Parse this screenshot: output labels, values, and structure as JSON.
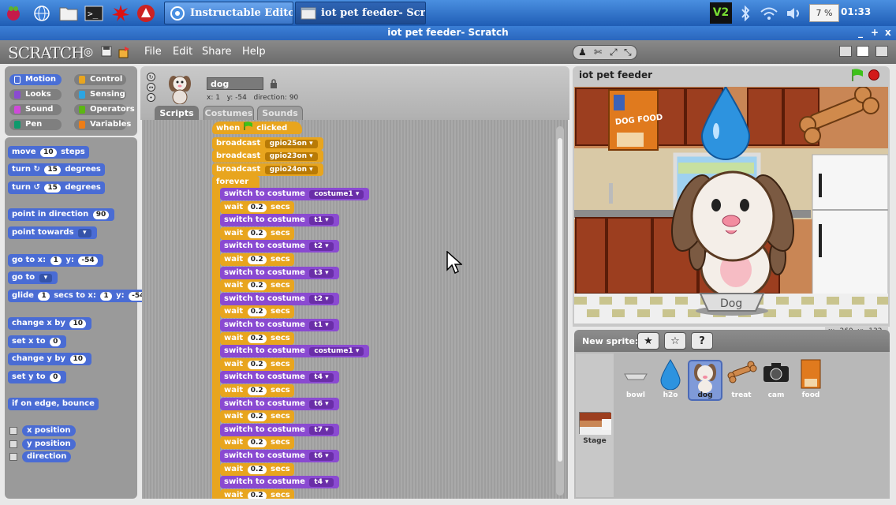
{
  "taskbar": {
    "tasks": [
      {
        "label": "Instructable Edito..."
      },
      {
        "label": "iot pet feeder- Scr..."
      }
    ],
    "volume_pct": "7 %",
    "clock": "01:33"
  },
  "window": {
    "title": "iot pet feeder- Scratch",
    "buttons": [
      "_",
      "+",
      "x"
    ]
  },
  "menubar": {
    "logo": "SCRATCH",
    "menus": [
      "File",
      "Edit",
      "Share",
      "Help"
    ]
  },
  "categories": [
    {
      "label": "Motion",
      "color": "#4a6cd4"
    },
    {
      "label": "Control",
      "color": "#e8a51e"
    },
    {
      "label": "Looks",
      "color": "#8a4ad1"
    },
    {
      "label": "Sensing",
      "color": "#2ca5e2"
    },
    {
      "label": "Sound",
      "color": "#cf4ad9"
    },
    {
      "label": "Operators",
      "color": "#5cb712"
    },
    {
      "label": "Pen",
      "color": "#0e9a6c"
    },
    {
      "label": "Variables",
      "color": "#ee7d16"
    }
  ],
  "palette": {
    "move": {
      "a": "move",
      "n": "10",
      "b": "steps"
    },
    "turn_cw": {
      "a": "turn",
      "n": "15",
      "b": "degrees"
    },
    "turn_ccw": {
      "a": "turn",
      "n": "15",
      "b": "degrees"
    },
    "point_dir": {
      "a": "point in direction",
      "n": "90"
    },
    "point_towards": {
      "a": "point towards"
    },
    "goto_xy": {
      "a": "go to x:",
      "x": "1",
      "y_label": "y:",
      "y": "-54"
    },
    "goto": {
      "a": "go to"
    },
    "glide": {
      "a": "glide",
      "n": "1",
      "b": "secs to x:",
      "x": "1",
      "y_label": "y:",
      "y": "-54"
    },
    "change_x": {
      "a": "change x by",
      "n": "10"
    },
    "set_x": {
      "a": "set x to",
      "n": "0"
    },
    "change_y": {
      "a": "change y by",
      "n": "10"
    },
    "set_y": {
      "a": "set y to",
      "n": "0"
    },
    "bounce": {
      "a": "if on edge, bounce"
    },
    "reporters": [
      "x position",
      "y position",
      "direction"
    ]
  },
  "sprite": {
    "name": "dog",
    "x_label": "x:",
    "x": "1",
    "y_label": "y:",
    "y": "-54",
    "dir_label": "direction:",
    "dir": "90"
  },
  "tabs": [
    "Scripts",
    "Costumes",
    "Sounds"
  ],
  "script": {
    "hat": {
      "a": "when",
      "b": "clicked"
    },
    "broadcasts": [
      {
        "label": "broadcast",
        "msg": "gpio25on"
      },
      {
        "label": "broadcast",
        "msg": "gpio23on"
      },
      {
        "label": "broadcast",
        "msg": "gpio24on"
      }
    ],
    "forever": "forever",
    "costume_label": "switch to costume",
    "wait_label": "wait",
    "wait_val": "0.2",
    "secs_label": "secs",
    "costumes": [
      "costume1",
      "t1",
      "t2",
      "t3",
      "t2",
      "t1",
      "costume1",
      "t4",
      "t6",
      "t7",
      "t6",
      "t4"
    ]
  },
  "stage": {
    "title": "iot pet feeder",
    "mouse_x_label": "x:",
    "mouse_x": "-260",
    "mouse_y_label": "y:",
    "mouse_y": "-132",
    "food_bag_text": "DOG FOOD",
    "bowl_text": "Dog"
  },
  "new_sprite": {
    "label": "New sprite:"
  },
  "sprites": [
    {
      "label": "bowl"
    },
    {
      "label": "h2o"
    },
    {
      "label": "dog"
    },
    {
      "label": "treat"
    },
    {
      "label": "cam"
    },
    {
      "label": "food"
    }
  ],
  "stage_thumb_label": "Stage"
}
